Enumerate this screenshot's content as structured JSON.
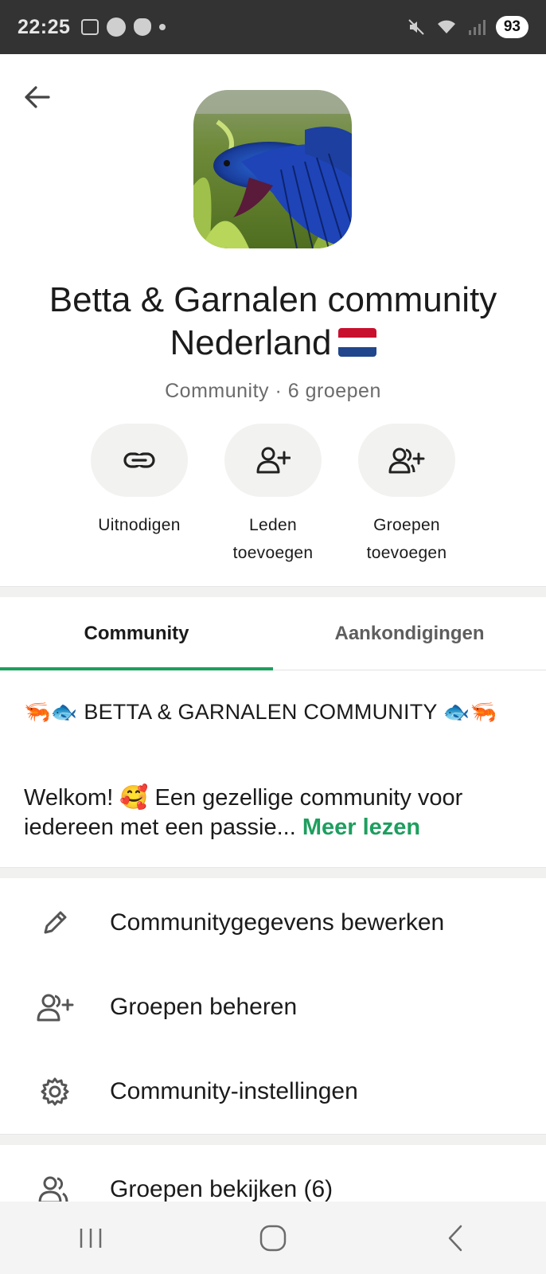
{
  "status_bar": {
    "time": "22:25",
    "battery": "93"
  },
  "header": {
    "back_icon": "arrow-left-icon",
    "community_name_line1": "Betta & Garnalen community",
    "community_name_line2": "Nederland",
    "subtitle": "Community · 6 groepen"
  },
  "actions": [
    {
      "label": "Uitnodigen",
      "icon": "link-icon"
    },
    {
      "label": "Leden toevoegen",
      "icon": "add-member-icon"
    },
    {
      "label": "Groepen toevoegen",
      "icon": "add-group-icon"
    }
  ],
  "tabs": [
    {
      "label": "Community",
      "active": true
    },
    {
      "label": "Aankondigingen",
      "active": false
    }
  ],
  "description": {
    "title": "BETTA & GARNALEN COMMUNITY",
    "text": "Welkom! 🥰 Een gezellige community voor iedereen met een passie...",
    "more": "Meer lezen"
  },
  "menu": [
    {
      "label": "Communitygegevens bewerken",
      "icon": "pencil-icon"
    },
    {
      "label": "Groepen beheren",
      "icon": "manage-groups-icon"
    },
    {
      "label": "Community-instellingen",
      "icon": "gear-icon"
    },
    {
      "label": "Groepen bekijken (6)",
      "icon": "groups-icon"
    }
  ],
  "colors": {
    "accent": "#1e9e5f",
    "status_bar": "#333333"
  }
}
